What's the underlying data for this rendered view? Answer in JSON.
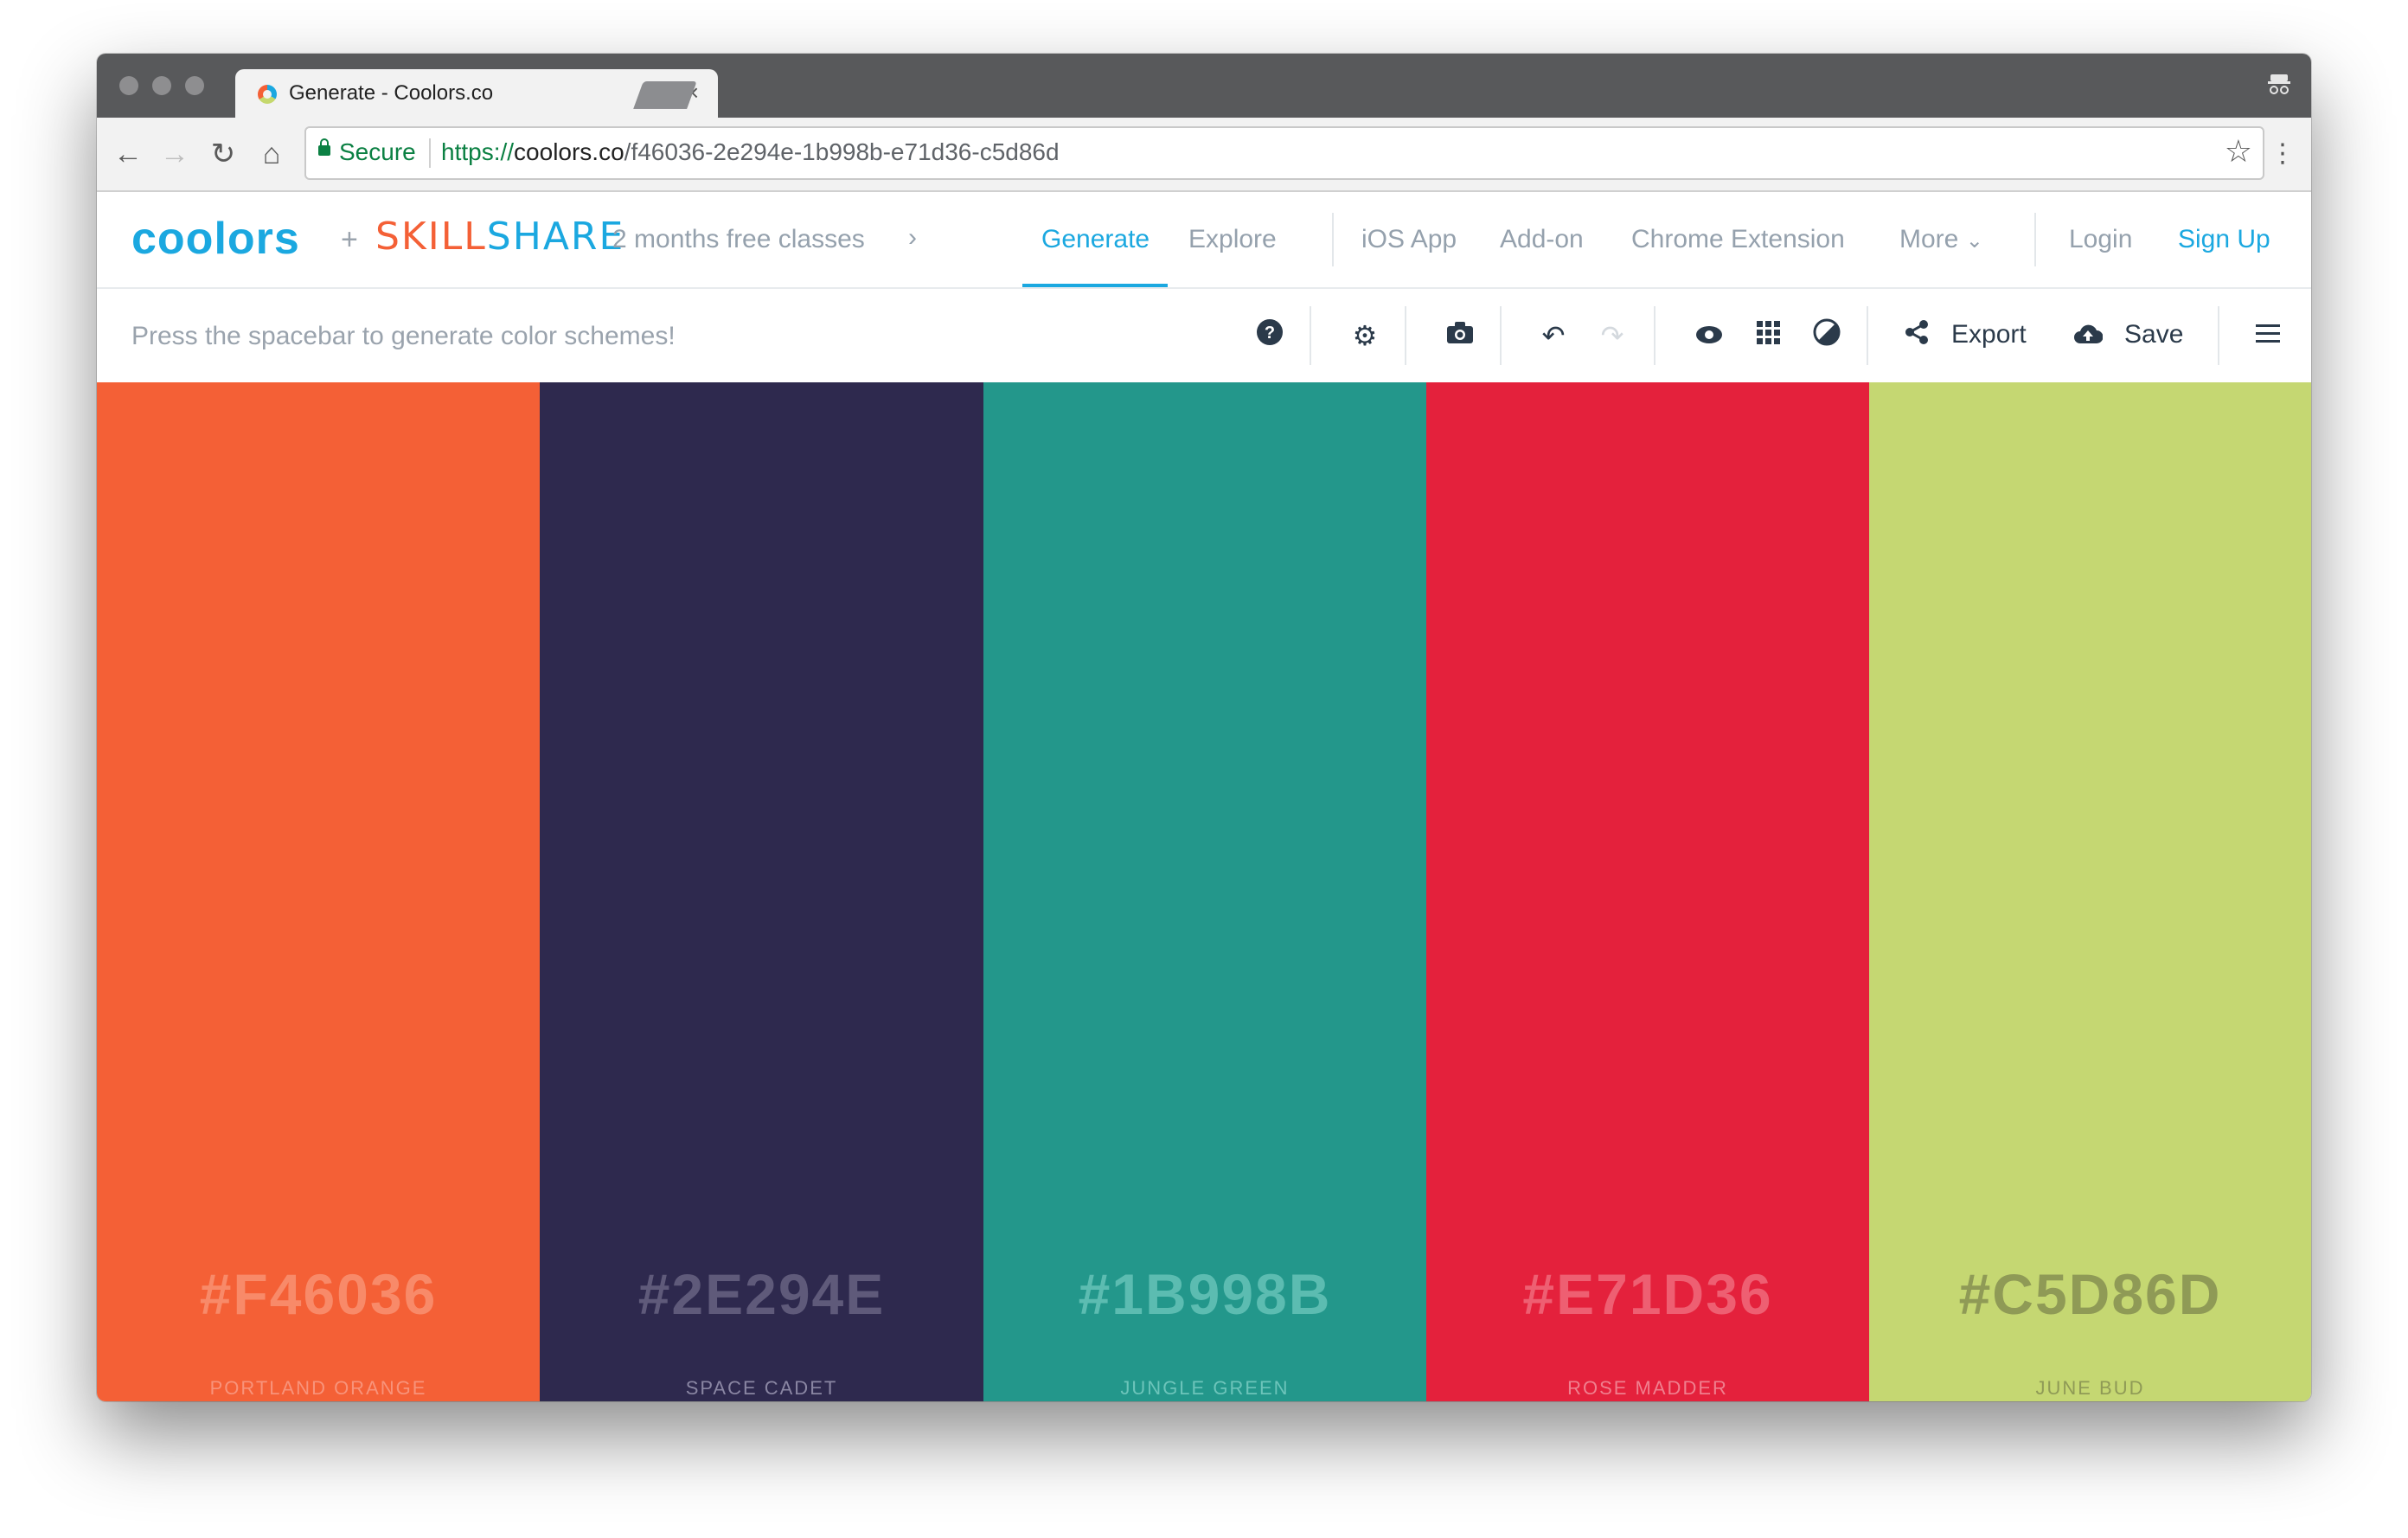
{
  "browser": {
    "tab_title": "Generate - Coolors.co",
    "tab_close": "×",
    "secure_label": "Secure",
    "url_scheme": "https://",
    "url_host": "coolors.co",
    "url_path": "/f46036-2e294e-1b998b-e71d36-c5d86d"
  },
  "header": {
    "logo": "coolors",
    "plus": "+",
    "skillshare": "SKILLSHARE",
    "promo": "2 months free classes",
    "nav": {
      "generate": "Generate",
      "explore": "Explore",
      "ios_app": "iOS App",
      "addon": "Add-on",
      "chrome_extension": "Chrome Extension",
      "more": "More",
      "login": "Login",
      "signup": "Sign Up"
    }
  },
  "toolbar": {
    "hint": "Press the spacebar to generate color schemes!",
    "export_label": "Export",
    "save_label": "Save"
  },
  "palette": [
    {
      "hex": "#F46036",
      "name": "PORTLAND ORANGE",
      "color": "#f46036",
      "text_color": "#f88a69",
      "name_color": "#f8937a"
    },
    {
      "hex": "#2E294E",
      "name": "SPACE CADET",
      "color": "#2e294e",
      "text_color": "#5f5a7a",
      "name_color": "#8a86a3"
    },
    {
      "hex": "#1B998B",
      "name": "JUNGLE GREEN",
      "color": "#23978b",
      "text_color": "#5cbcb1",
      "name_color": "#6cc4ba"
    },
    {
      "hex": "#E71D36",
      "name": "ROSE MADDER",
      "color": "#e4213c",
      "text_color": "#ee5f72",
      "name_color": "#f07f8e"
    },
    {
      "hex": "#C5D86D",
      "name": "JUNE BUD",
      "color": "#c5d772",
      "text_color": "#8f9a56",
      "name_color": "#8f9a56"
    }
  ],
  "colors": {
    "accent": "#1ba8e0",
    "muted_text": "#95a1ad",
    "icon_dark": "#2b3a4a"
  }
}
